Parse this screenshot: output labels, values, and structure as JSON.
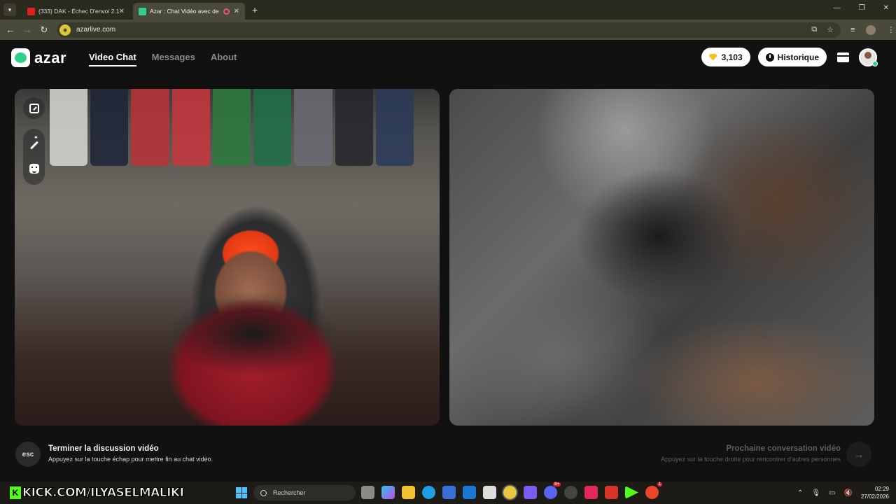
{
  "browser": {
    "tabs": [
      {
        "label": "(333) DAK - Échec D'envoi 2.1 (",
        "favicon": "youtube-icon",
        "active": false
      },
      {
        "label": "Azar : Chat Vidéo avec de n",
        "favicon": "azar-icon",
        "active": true
      }
    ],
    "url": "azarlive.com"
  },
  "header": {
    "logo_text": "azar",
    "nav": [
      {
        "label": "Video Chat",
        "active": true
      },
      {
        "label": "Messages",
        "active": false
      },
      {
        "label": "About",
        "active": false
      }
    ],
    "gems_count": "3,103",
    "history_label": "Historique"
  },
  "bottom": {
    "esc_key": "esc",
    "end_title": "Terminer la discussion vidéo",
    "end_subtitle": "Appuyez sur la touche échap pour mettre fin au chat vidéo.",
    "next_title": "Prochaine conversation vidéo",
    "next_subtitle": "Appuyez sur la touche droite pour rencontrer d'autres personnes",
    "next_arrow": "→"
  },
  "taskbar": {
    "overlay_text": "KICK.COM/ILYASELMALIKI",
    "search_placeholder": "Rechercher",
    "time": "02:29",
    "date": "27/02/2026",
    "discord_badge": "9+",
    "app_badge": "1"
  },
  "colors": {
    "brand_green": "#2fd18a",
    "gem_gold": "#f4c21a",
    "page_bg": "#111111"
  }
}
